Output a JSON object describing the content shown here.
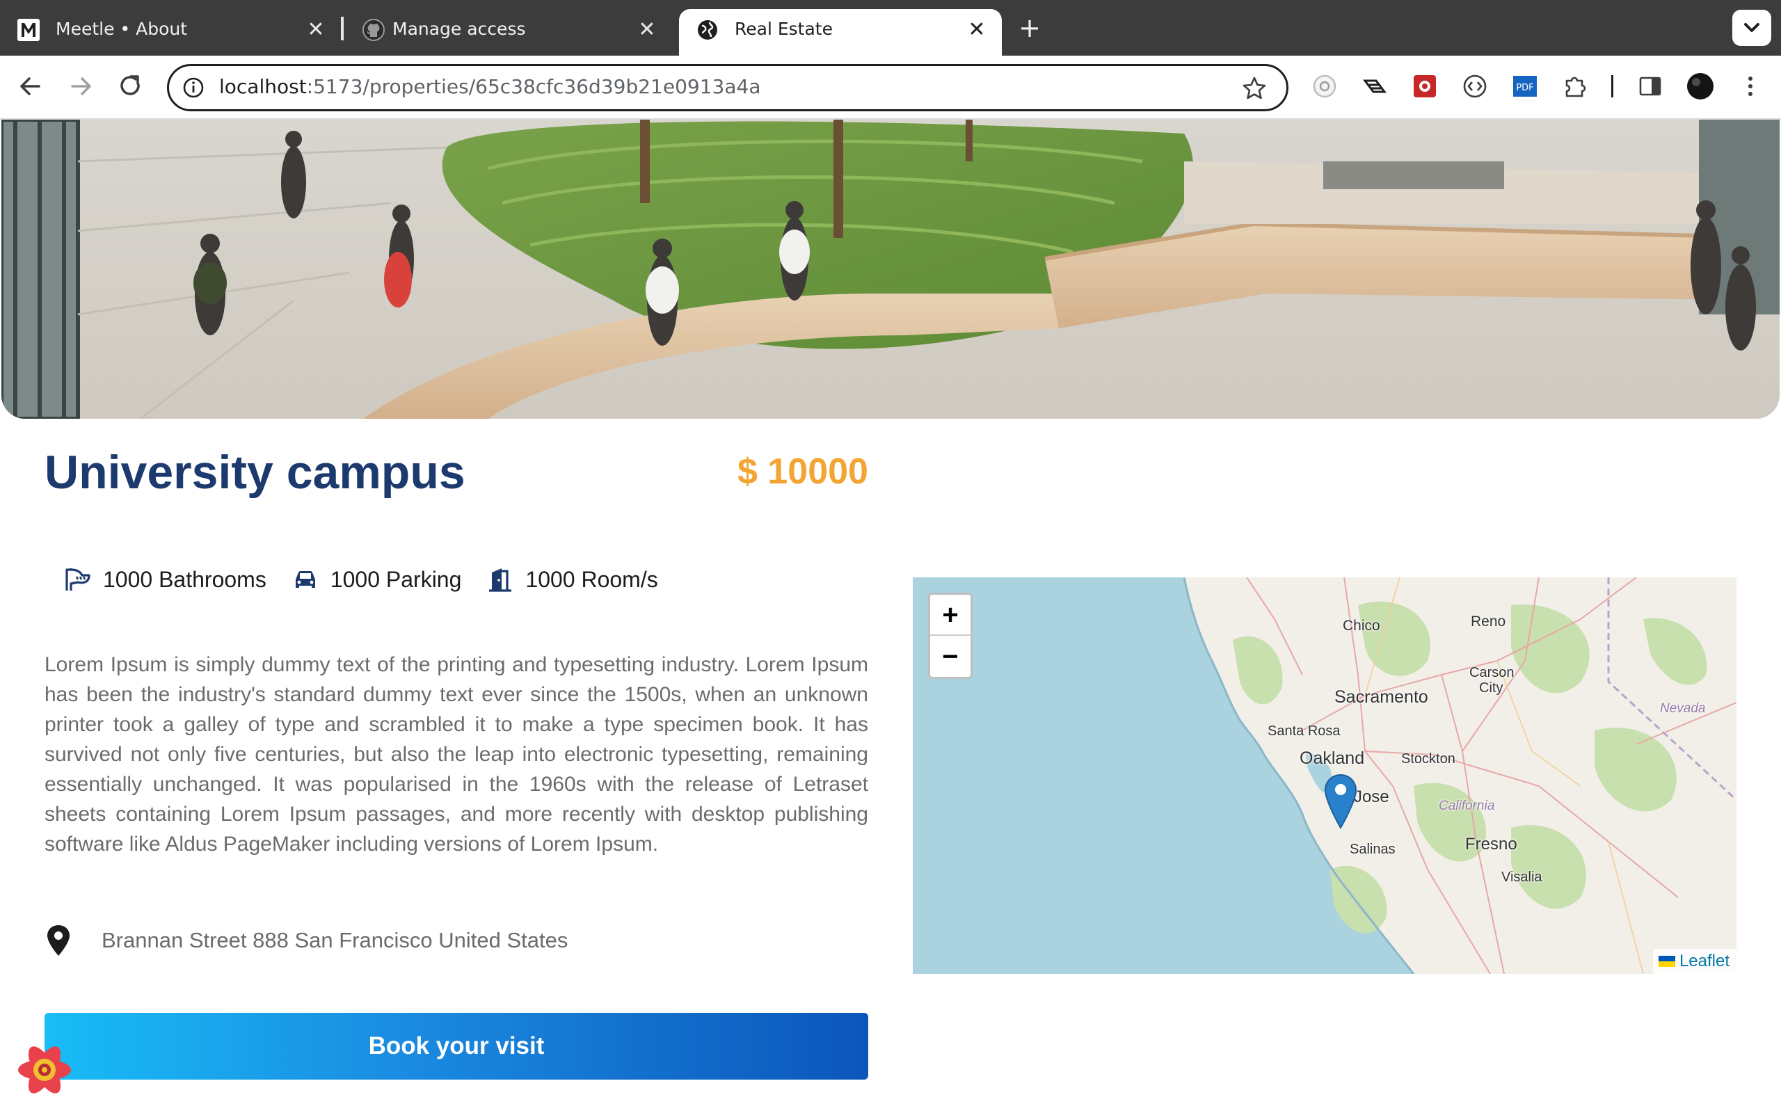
{
  "browser": {
    "tabs": [
      {
        "title": "Meetle • About",
        "icon": "meetle-m-icon",
        "active": false
      },
      {
        "title": "Manage access",
        "icon": "github-icon",
        "active": false
      },
      {
        "title": "Real Estate",
        "icon": "globe-icon",
        "active": true
      }
    ],
    "close_glyph": "✕",
    "new_tab_glyph": "+",
    "url_host": "localhost",
    "url_path": ":5173/properties/65c38cfc36d39b21e0913a4a"
  },
  "property": {
    "title": "University campus",
    "price": "$ 10000",
    "features": [
      {
        "label": "1000 Bathrooms",
        "icon": "bath-icon"
      },
      {
        "label": "1000 Parking",
        "icon": "car-icon"
      },
      {
        "label": "1000 Room/s",
        "icon": "door-icon"
      }
    ],
    "description": "Lorem Ipsum is simply dummy text of the printing and typesetting industry. Lorem Ipsum has been the industry's standard dummy text ever since the 1500s, when an unknown printer took a galley of type and scrambled it to make a type specimen book. It has survived not only five centuries, but also the leap into electronic typesetting, remaining essentially unchanged. It was popularised in the 1960s with the release of Letraset sheets containing Lorem Ipsum passages, and more recently with desktop publishing software like Aldus PageMaker including versions of Lorem Ipsum.",
    "address": "Brannan Street 888 San Francisco United States",
    "book_label": "Book your visit"
  },
  "map": {
    "zoom_in": "+",
    "zoom_out": "−",
    "attribution": "Leaflet",
    "labels": {
      "chico": "Chico",
      "reno": "Reno",
      "carson": "Carson",
      "city": "City",
      "sacramento": "Sacramento",
      "nevada": "Nevada",
      "santa_rosa": "Santa Rosa",
      "oakland": "Oakland",
      "stockton": "Stockton",
      "jose": "Jose",
      "california": "California",
      "fresno": "Fresno",
      "salinas": "Salinas",
      "visalia": "Visalia"
    }
  },
  "colors": {
    "title": "#1d3a6e",
    "price": "#f3a533",
    "button_start": "#18bdf6",
    "button_end": "#0b56bb",
    "water": "#aad3df",
    "marker": "#2a81cb"
  }
}
